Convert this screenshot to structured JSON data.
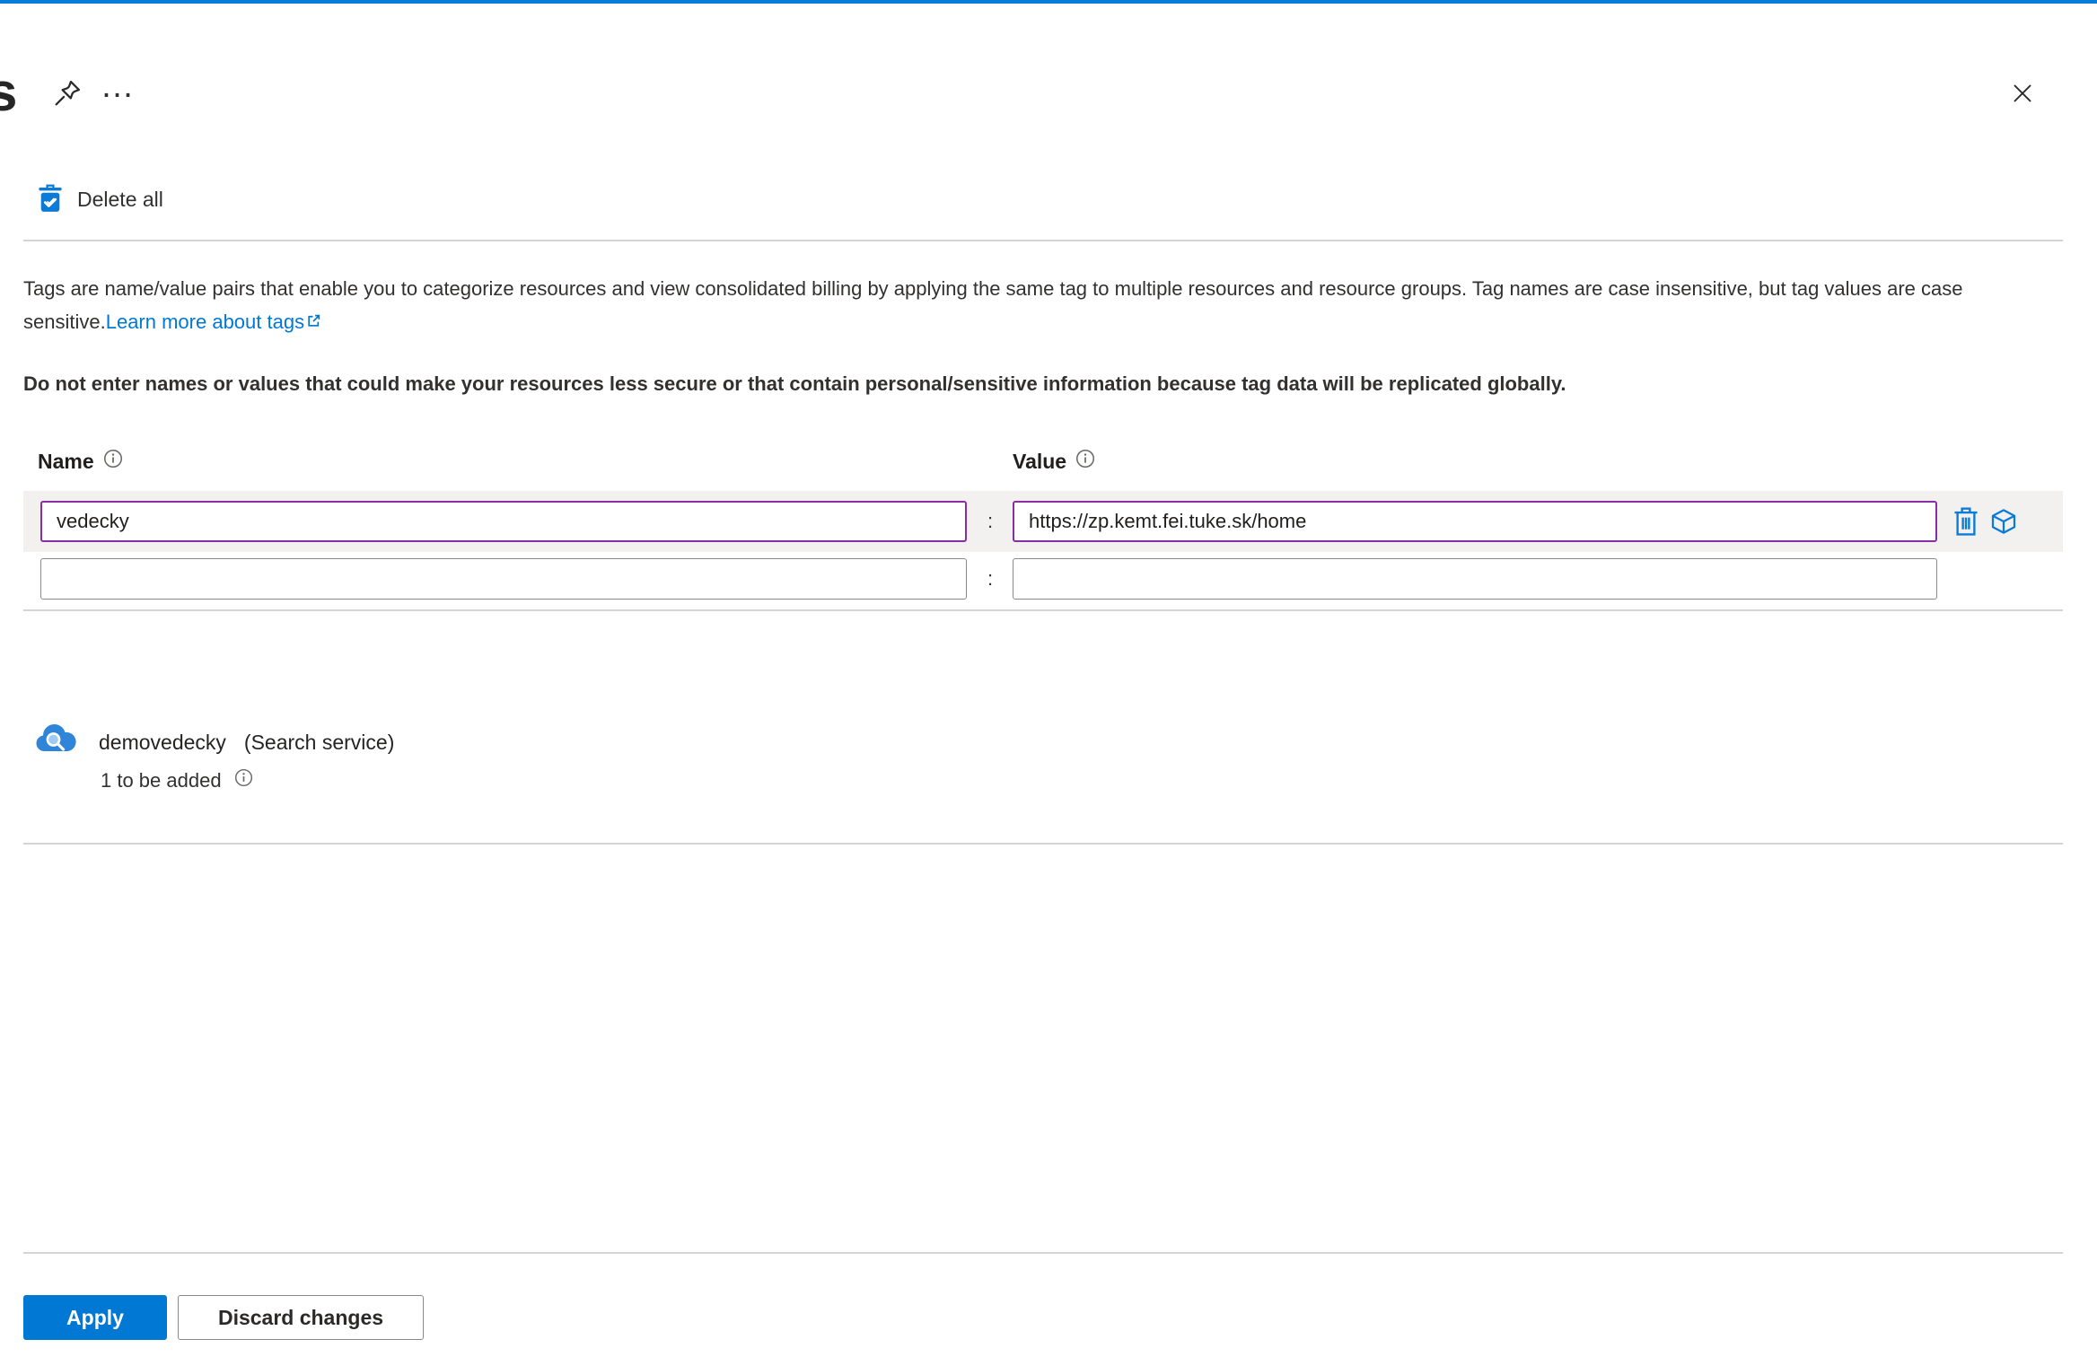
{
  "colors": {
    "accent": "#0078d4",
    "dirty_input_border": "#8a2da5",
    "row_highlight": "#f2f1f0",
    "divider": "#d6d4d2",
    "neutral_border": "#8b8886",
    "text": "#323130"
  },
  "header": {
    "title_partial": "s",
    "more_label": "…",
    "icons": {
      "pin": "pin-icon",
      "more": "ellipsis-icon",
      "close": "close-icon"
    }
  },
  "toolbar": {
    "delete_all_label": "Delete all",
    "delete_all_icon": "trash-check-icon"
  },
  "intro": {
    "text_before_link": "Tags are name/value pairs that enable you to categorize resources and view consolidated billing by applying the same tag to multiple resources and resource groups. Tag names are case insensitive, but tag values are case sensitive.",
    "link_label": "Learn more about tags",
    "link_icon": "external-link-icon",
    "warning": "Do not enter names or values that could make your resources less secure or that contain personal/sensitive information because tag data will be replicated globally."
  },
  "tag_editor": {
    "name_header": "Name",
    "value_header": "Value",
    "info_icon": "info-icon",
    "separator": ":",
    "rows": [
      {
        "name": "vedecky",
        "value": "https://zp.kemt.fei.tuke.sk/home",
        "state": "modified"
      },
      {
        "name": "",
        "value": "",
        "state": "empty"
      }
    ],
    "row_actions": {
      "delete_icon": "trash-icon",
      "resource_icon": "cube-icon"
    }
  },
  "resources": {
    "items": [
      {
        "icon": "search-service-icon",
        "name": "demovedecky",
        "type": "(Search service)",
        "pending": "1 to be added"
      }
    ]
  },
  "footer": {
    "apply_label": "Apply",
    "discard_label": "Discard changes"
  }
}
